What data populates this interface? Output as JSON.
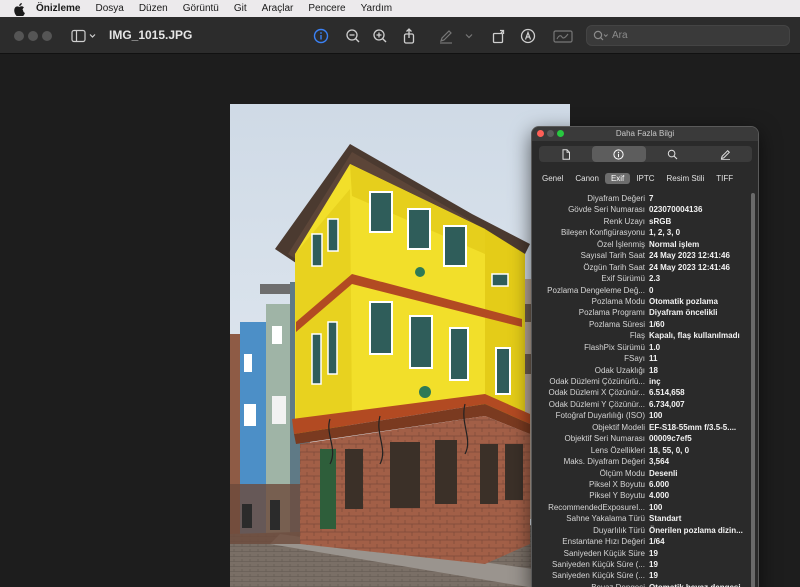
{
  "menubar": {
    "app": "Önizleme",
    "items": [
      "Dosya",
      "Düzen",
      "Görüntü",
      "Git",
      "Araçlar",
      "Pencere",
      "Yardım"
    ]
  },
  "toolbar": {
    "title": "IMG_1015.JPG",
    "search_placeholder": "Ara"
  },
  "panel": {
    "title": "Daha Fazla Bilgi",
    "segments": [
      "document-icon",
      "info-icon",
      "magnifier-icon",
      "pencil-icon"
    ],
    "tabs": [
      "Genel",
      "Canon",
      "Exif",
      "IPTC",
      "Resim Stili",
      "TIFF"
    ],
    "active_tab": "Exif",
    "rows": [
      {
        "k": "Diyafram Değeri",
        "v": "7"
      },
      {
        "k": "Gövde Seri Numarası",
        "v": "023070004136"
      },
      {
        "k": "Renk Uzayı",
        "v": "sRGB"
      },
      {
        "k": "Bileşen Konfigürasyonu",
        "v": "1, 2, 3, 0"
      },
      {
        "k": "Özel İşlenmiş",
        "v": "Normal işlem"
      },
      {
        "k": "Sayısal Tarih Saat",
        "v": "24 May 2023 12:41:46"
      },
      {
        "k": "Özgün Tarih Saat",
        "v": "24 May 2023 12:41:46"
      },
      {
        "k": "Exif Sürümü",
        "v": "2.3"
      },
      {
        "k": "Pozlama Dengeleme Değ...",
        "v": "0"
      },
      {
        "k": "Pozlama Modu",
        "v": "Otomatik pozlama"
      },
      {
        "k": "Pozlama Programı",
        "v": "Diyafram öncelikli"
      },
      {
        "k": "Pozlama Süresi",
        "v": "1/60"
      },
      {
        "k": "Flaş",
        "v": "Kapalı, flaş kullanılmadı"
      },
      {
        "k": "FlashPix Sürümü",
        "v": "1.0"
      },
      {
        "k": "FSayı",
        "v": "11"
      },
      {
        "k": "Odak Uzaklığı",
        "v": "18"
      },
      {
        "k": "Odak Düzlemi Çözünürlü...",
        "v": "inç"
      },
      {
        "k": "Odak Düzlemi X Çözünür...",
        "v": "6.514,658"
      },
      {
        "k": "Odak Düzlemi Y Çözünür...",
        "v": "6.734,007"
      },
      {
        "k": "Fotoğraf Duyarlılığı (ISO)",
        "v": "100"
      },
      {
        "k": "Objektif Modeli",
        "v": "EF-S18-55mm f/3.5-5...."
      },
      {
        "k": "Objektif Seri Numarası",
        "v": "00009c7ef5"
      },
      {
        "k": "Lens Özellikleri",
        "v": "18, 55, 0, 0"
      },
      {
        "k": "Maks. Diyafram Değeri",
        "v": "3,564"
      },
      {
        "k": "Ölçüm Modu",
        "v": "Desenli"
      },
      {
        "k": "Piksel X Boyutu",
        "v": "6.000"
      },
      {
        "k": "Piksel Y Boyutu",
        "v": "4.000"
      },
      {
        "k": "RecommendedExposureI...",
        "v": "100"
      },
      {
        "k": "Sahne Yakalama Türü",
        "v": "Standart"
      },
      {
        "k": "Duyarlılık Türü",
        "v": "Önerilen pozlama dizin..."
      },
      {
        "k": "Enstantane Hızı Değeri",
        "v": "1/64"
      },
      {
        "k": "Saniyeden Küçük Süre",
        "v": "19"
      },
      {
        "k": "Saniyeden Küçük Süre (...",
        "v": "19"
      },
      {
        "k": "Saniyeden Küçük Süre (...",
        "v": "19"
      },
      {
        "k": "Beyaz Dengesi",
        "v": "Otomatik beyaz dengesi"
      }
    ]
  },
  "colors": {
    "menubar_bg": "#eceaec",
    "toolbar_bg": "#2c2c2c",
    "accent_blue": "#3b82f6",
    "facade_yellow": "#f2df2a",
    "brick": "#a2614a"
  }
}
